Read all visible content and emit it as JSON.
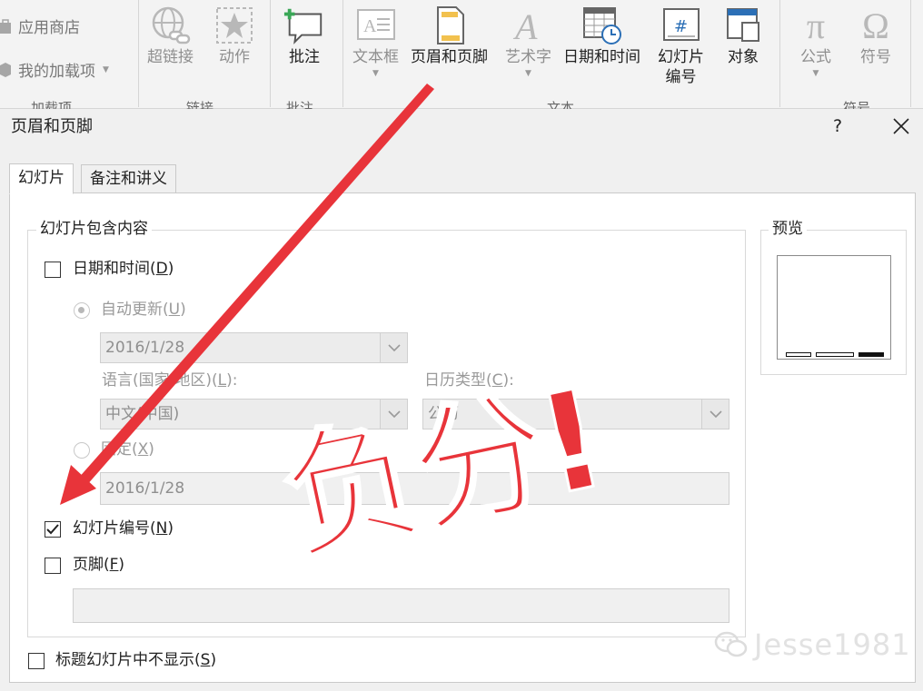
{
  "ribbon": {
    "addins": {
      "store_label": "应用商店",
      "my_addins_label": "我的加载项",
      "group_label": "加载项"
    },
    "links": {
      "hyperlink_label": "超链接",
      "action_label": "动作",
      "group_label": "链接"
    },
    "comments": {
      "comment_label": "批注",
      "group_label": "批注"
    },
    "text": {
      "textbox_label": "文本框",
      "header_footer_label": "页眉和页脚",
      "wordart_label": "艺术字",
      "datetime_label": "日期和时间",
      "slide_number_label_line1": "幻灯片",
      "slide_number_label_line2": "编号",
      "object_label": "对象",
      "group_label": "文本"
    },
    "symbols": {
      "equation_label": "公式",
      "symbol_label": "符号",
      "group_label": "符号",
      "equation_glyph": "π",
      "symbol_glyph": "Ω"
    }
  },
  "dialog": {
    "title": "页眉和页脚",
    "help": "?",
    "tabs": [
      {
        "label": "幻灯片",
        "active": true
      },
      {
        "label": "备注和讲义",
        "active": false
      }
    ],
    "include_group_label": "幻灯片包含内容",
    "date_time": {
      "label": "日期和时间",
      "key": "D",
      "checked": false
    },
    "auto_update": {
      "label": "自动更新",
      "key": "U",
      "selected": true
    },
    "auto_date_value": "2016/1/28",
    "language": {
      "label_prefix": "语言(国家/地区)(",
      "key": "L",
      "label_suffix": "):",
      "value": "中文(中国)"
    },
    "calendar": {
      "label_prefix": "日历类型(",
      "key": "C",
      "label_suffix": "):",
      "value": "公历"
    },
    "fixed": {
      "label": "固定",
      "key": "X",
      "selected": false,
      "value": "2016/1/28"
    },
    "slide_number": {
      "label": "幻灯片编号",
      "key": "N",
      "checked": true
    },
    "footer": {
      "label": "页脚",
      "key": "F",
      "checked": false,
      "value": ""
    },
    "dont_show_title": {
      "label": "标题幻灯片中不显示",
      "key": "S",
      "checked": false
    },
    "preview_label": "预览",
    "preview": {
      "footer_slots": [
        "date",
        "footer",
        "slide-number"
      ],
      "active_slot": "slide-number"
    }
  },
  "annotation": {
    "stamp_text": "负分!",
    "stamp_color": "#e8343a",
    "arrow_color": "#e8343a"
  },
  "watermark": {
    "text": "Jesse1981"
  },
  "colors": {
    "ribbon_bg": "#f3f3f3",
    "dialog_bg": "#f0f0f0",
    "accent_red": "#e8343a"
  }
}
